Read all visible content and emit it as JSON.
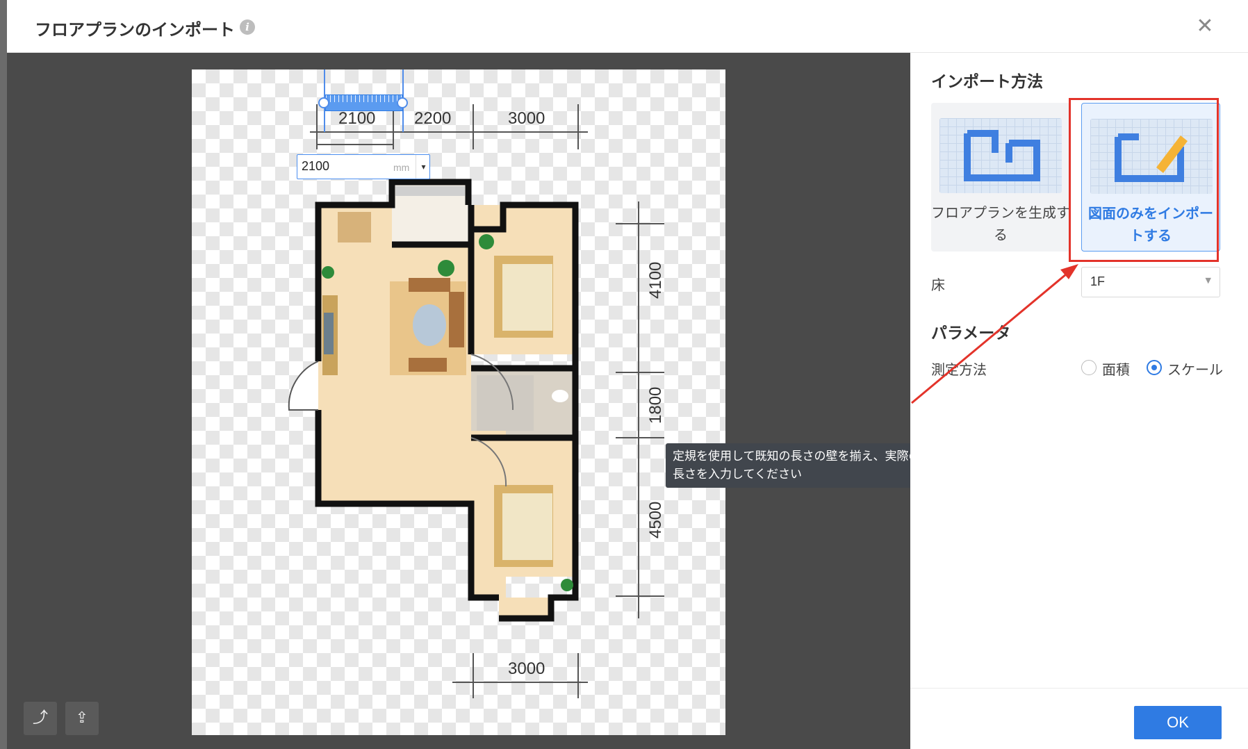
{
  "dialog": {
    "title": "フロアプランのインポート",
    "info_icon": "info-icon",
    "close_icon": "close-icon",
    "close_glyph": "✕"
  },
  "canvas": {
    "dimensions_top": [
      "2100",
      "2200",
      "3000"
    ],
    "dimensions_right": [
      "4100",
      "1800",
      "4500"
    ],
    "dimensions_bottom": [
      "3000"
    ],
    "length_input": {
      "value": "2100",
      "unit": "mm",
      "dropdown_glyph": "▾"
    },
    "tooltip": "定規を使用して既知の長さの壁を揃え、実際の長さを入力してください",
    "tools": [
      {
        "name": "rotate-icon",
        "glyph": "⤴"
      },
      {
        "name": "upload-icon",
        "glyph": "⇪"
      }
    ]
  },
  "right_panel": {
    "import_method_title": "インポート方法",
    "cards": [
      {
        "label": "フロアプランを生成する",
        "selected": false
      },
      {
        "label": "図面のみをインポートする",
        "selected": true
      }
    ],
    "floor_label": "床",
    "floor_value": "1F",
    "params_title": "パラメータ",
    "measure_label": "測定方法",
    "measure_options": [
      {
        "label": "面積",
        "checked": false
      },
      {
        "label": "スケール",
        "checked": true
      }
    ],
    "ok_label": "OK"
  },
  "colors": {
    "accent": "#2f7be3",
    "highlight": "#e3332a",
    "canvas_bg": "#4a4a4a"
  }
}
